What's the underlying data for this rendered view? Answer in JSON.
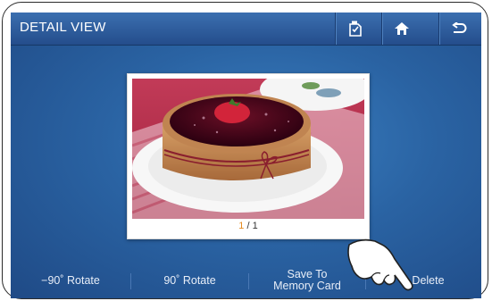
{
  "header": {
    "title": "DETAIL VIEW",
    "buttons": [
      "edit-icon",
      "home-icon",
      "back-icon"
    ]
  },
  "photo": {
    "current": "1",
    "separator": " / ",
    "total": "1"
  },
  "toolbar": {
    "rotate_left": "−90˚ Rotate",
    "rotate_right": "90˚ Rotate",
    "save_line1": "Save To",
    "save_line2": "Memory Card",
    "delete": "Delete"
  },
  "colors": {
    "header": "#2f5e9f",
    "background": "#2a63a3",
    "counter_current": "#e58a1f"
  }
}
